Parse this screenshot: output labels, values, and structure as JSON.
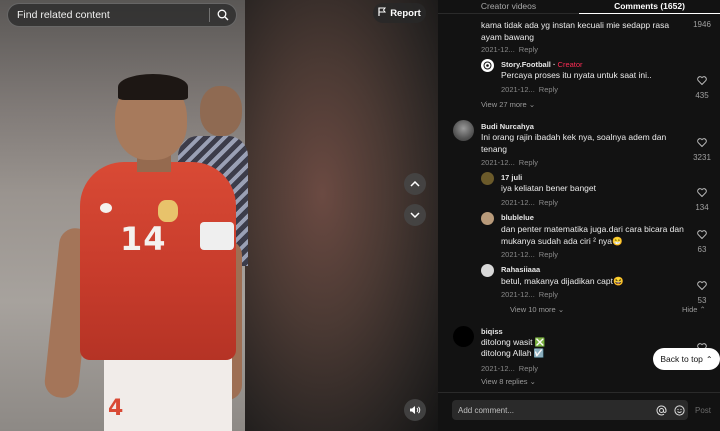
{
  "video": {
    "search_placeholder": "Find related content",
    "report_label": "Report",
    "icons": {
      "search": "search-icon",
      "report": "flag-icon",
      "up": "chevron-up-icon",
      "down": "chevron-down-icon",
      "volume": "volume-icon"
    },
    "jersey_number": "14"
  },
  "tabs": [
    {
      "label": "Creator videos",
      "active": false
    },
    {
      "label": "Comments (1652)",
      "active": true
    }
  ],
  "comments": {
    "c1": {
      "text": "kama tidak ada yg instan kecuali mie sedapp rasa ayam bawang",
      "date": "2021-12...",
      "reply": "Reply",
      "likes": "1946"
    },
    "c1r1": {
      "user": "Story.Football",
      "badge": "Creator",
      "text": "Percaya proses itu nyata untuk saat ini..",
      "date": "2021-12...",
      "reply": "Reply",
      "likes": "435"
    },
    "c1_more": "View 27 more",
    "c2": {
      "user": "Budi Nurcahya",
      "text": "Ini orang rajin ibadah kek nya, soalnya adem dan tenang",
      "date": "2021-12...",
      "reply": "Reply",
      "likes": "3231"
    },
    "c2r1": {
      "user": "17 juli",
      "text": "iya keliatan bener banget",
      "date": "2021-12...",
      "reply": "Reply",
      "likes": "134"
    },
    "c2r2": {
      "user": "blublelue",
      "text": "dan penter matematika juga.dari cara bicara dan mukanya sudah ada ciri ² nya😁",
      "date": "2021-12...",
      "reply": "Reply",
      "likes": "63"
    },
    "c2r3": {
      "user": "Rahasiiaaa",
      "text": "betul, makanya dijadikan capt😆",
      "date": "2021-12...",
      "reply": "Reply",
      "likes": "53"
    },
    "c2_more": "View 10 more",
    "c2_hide": "Hide",
    "c3": {
      "user": "biqiss",
      "line1": "ditolong wasit ❎",
      "line2": "ditolong Allah ☑️",
      "date": "2021-12...",
      "reply": "Reply"
    },
    "c3_more": "View 8 replies"
  },
  "back_to_top": "Back to top",
  "composer": {
    "placeholder": "Add comment...",
    "post": "Post",
    "icons": {
      "mention": "at-icon",
      "emoji": "emoji-icon"
    }
  },
  "colors": {
    "accent": "#fe2c55",
    "panel_bg": "#121212"
  }
}
